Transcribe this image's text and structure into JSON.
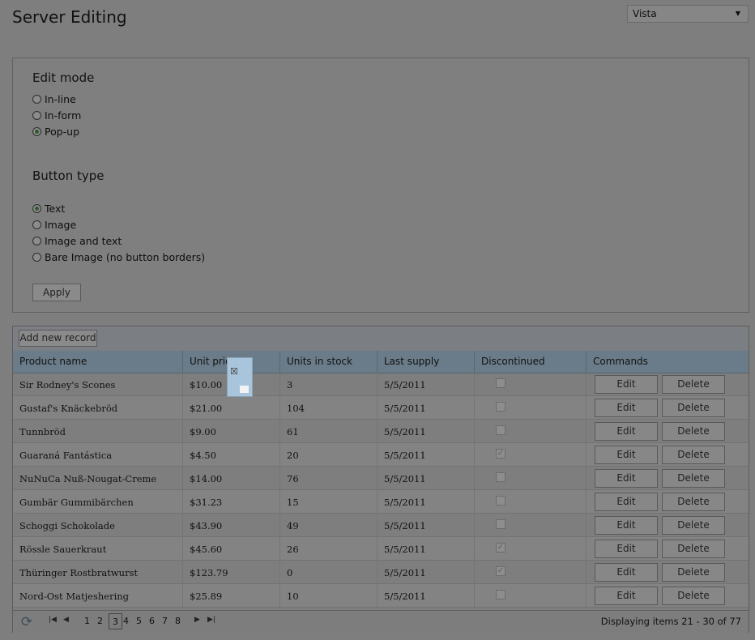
{
  "page_title": "Server Editing",
  "skin_select": {
    "value": "Vista"
  },
  "edit_mode": {
    "heading": "Edit mode",
    "options": [
      {
        "label": "In-line",
        "checked": false
      },
      {
        "label": "In-form",
        "checked": false
      },
      {
        "label": "Pop-up",
        "checked": true
      }
    ]
  },
  "button_type": {
    "heading": "Button type",
    "options": [
      {
        "label": "Text",
        "checked": true
      },
      {
        "label": "Image",
        "checked": false
      },
      {
        "label": "Image and text",
        "checked": false
      },
      {
        "label": "Bare Image (no button borders)",
        "checked": false
      }
    ]
  },
  "apply_label": "Apply",
  "grid": {
    "add_new_label": "Add new record",
    "columns": [
      "Product name",
      "Unit price",
      "Units in stock",
      "Last supply",
      "Discontinued",
      "Commands"
    ],
    "edit_label": "Edit",
    "delete_label": "Delete",
    "rows": [
      {
        "name": "Sir Rodney's Scones",
        "price": "$10.00",
        "stock": "3",
        "supply": "5/5/2011",
        "discontinued": false
      },
      {
        "name": "Gustaf's Knäckebröd",
        "price": "$21.00",
        "stock": "104",
        "supply": "5/5/2011",
        "discontinued": false
      },
      {
        "name": "Tunnbröd",
        "price": "$9.00",
        "stock": "61",
        "supply": "5/5/2011",
        "discontinued": false
      },
      {
        "name": "Guaraná Fantástica",
        "price": "$4.50",
        "stock": "20",
        "supply": "5/5/2011",
        "discontinued": true
      },
      {
        "name": "NuNuCa Nuß-Nougat-Creme",
        "price": "$14.00",
        "stock": "76",
        "supply": "5/5/2011",
        "discontinued": false
      },
      {
        "name": "Gumbär Gummibärchen",
        "price": "$31.23",
        "stock": "15",
        "supply": "5/5/2011",
        "discontinued": false
      },
      {
        "name": "Schoggi Schokolade",
        "price": "$43.90",
        "stock": "49",
        "supply": "5/5/2011",
        "discontinued": false
      },
      {
        "name": "Rössle Sauerkraut",
        "price": "$45.60",
        "stock": "26",
        "supply": "5/5/2011",
        "discontinued": true
      },
      {
        "name": "Thüringer Rostbratwurst",
        "price": "$123.79",
        "stock": "0",
        "supply": "5/5/2011",
        "discontinued": true
      },
      {
        "name": "Nord-Ost Matjeshering",
        "price": "$25.89",
        "stock": "10",
        "supply": "5/5/2011",
        "discontinued": false
      }
    ],
    "pager": {
      "pages": [
        "1",
        "2",
        "3",
        "4",
        "5",
        "6",
        "7",
        "8"
      ],
      "current_page": "3",
      "info": "Displaying items 21 - 30 of 77"
    }
  },
  "icons": {
    "refresh": "refresh-icon",
    "first": "first-page-icon",
    "prev": "prev-page-icon",
    "next": "next-page-icon",
    "last": "last-page-icon",
    "dropdown": "chevron-down-icon",
    "loading": "loading-indicator-icon"
  }
}
